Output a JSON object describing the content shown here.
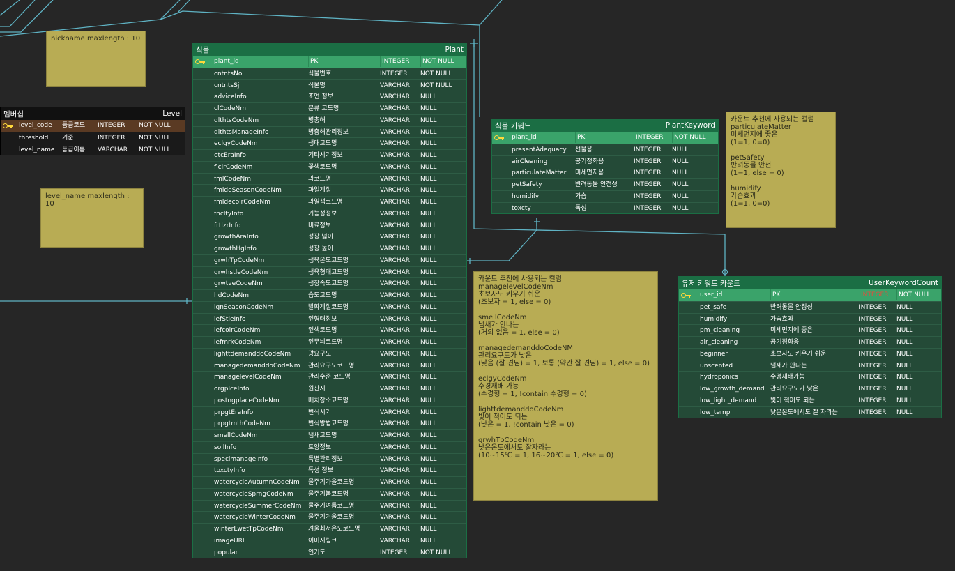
{
  "notes": {
    "nickname": [
      "nickname maxlength : 10"
    ],
    "level_name": [
      "level_name maxlength : 10"
    ],
    "plant_reco": [
      "카운트 추천에 사용되는 컬럼",
      "managelevelCodeNm",
      "초보자도 키우기 쉬운",
      "(초보자 = 1, else = 0)",
      "",
      "smellCodeNm",
      "냄새가 안나는",
      "(거의 없음 = 1, else = 0)",
      "",
      "managedemanddoCodeNM",
      "관리요구도가 낮은",
      "(낮음 (잘 견딤) = 1, 보통 (약간 잘 견딤) = 1, else = 0)",
      "",
      "eclgyCodeNm",
      "수경재배 가능",
      "(수경형 = 1, !contain 수경형 = 0)",
      "",
      "lighttdemanddoCodeNm",
      "빛이 적어도 되는",
      "(낮은 = 1, !contain 낮은 = 0)",
      "",
      "grwhTpCodeNm",
      "낮은온도에서도 잘자라는",
      "(10~15℃ = 1, 16~20℃ = 1, else = 0)"
    ],
    "keyword_reco": [
      "카운트 추천에 사용되는 컬럼",
      "particulateMatter",
      "미세먼지에 좋은",
      "(1=1, 0=0)",
      "",
      "petSafety",
      "반려동물 안전",
      "(1=1, else = 0)",
      "",
      "humidify",
      "가습효과",
      "(1=1, 0=0)"
    ]
  },
  "level": {
    "logical": "멤버십",
    "physical": "Level",
    "rows": [
      {
        "col": "level_code",
        "name": "등급코드",
        "type": "INTEGER",
        "nn": "NOT NULL",
        "pk": true
      },
      {
        "col": "threshold",
        "name": "기준",
        "type": "INTEGER",
        "nn": "NOT NULL",
        "pk": false
      },
      {
        "col": "level_name",
        "name": "등급이름",
        "type": "VARCHAR",
        "nn": "NOT NULL",
        "pk": false
      }
    ]
  },
  "plant": {
    "logical": "식물",
    "physical": "Plant",
    "rows": [
      {
        "col": "plant_id",
        "name": "PK",
        "type": "INTEGER",
        "nn": "NOT NULL",
        "pk": true
      },
      {
        "col": "cntntsNo",
        "name": "식물번호",
        "type": "INTEGER",
        "nn": "NOT NULL",
        "pk": false
      },
      {
        "col": "cntntsSj",
        "name": "식물명",
        "type": "VARCHAR",
        "nn": "NOT NULL",
        "pk": false
      },
      {
        "col": "adviceInfo",
        "name": "조언 정보",
        "type": "VARCHAR",
        "nn": "NULL",
        "pk": false
      },
      {
        "col": "clCodeNm",
        "name": "분류 코드명",
        "type": "VARCHAR",
        "nn": "NULL",
        "pk": false
      },
      {
        "col": "dlthtsCodeNm",
        "name": "병충해",
        "type": "VARCHAR",
        "nn": "NULL",
        "pk": false
      },
      {
        "col": "dlthtsManageInfo",
        "name": "병충해관리정보",
        "type": "VARCHAR",
        "nn": "NULL",
        "pk": false
      },
      {
        "col": "eclgyCodeNm",
        "name": "생태코드명",
        "type": "VARCHAR",
        "nn": "NULL",
        "pk": false
      },
      {
        "col": "etcEraInfo",
        "name": "기타시기정보",
        "type": "VARCHAR",
        "nn": "NULL",
        "pk": false
      },
      {
        "col": "flclrCodeNm",
        "name": "꽃색코드명",
        "type": "VARCHAR",
        "nn": "NULL",
        "pk": false
      },
      {
        "col": "fmlCodeNm",
        "name": "과코드명",
        "type": "VARCHAR",
        "nn": "NULL",
        "pk": false
      },
      {
        "col": "fmldeSeasonCodeNm",
        "name": "과일계절",
        "type": "VARCHAR",
        "nn": "NULL",
        "pk": false
      },
      {
        "col": "fmldecolrCodeNm",
        "name": "과일색코드명",
        "type": "VARCHAR",
        "nn": "NULL",
        "pk": false
      },
      {
        "col": "fncltyInfo",
        "name": "기능성정보",
        "type": "VARCHAR",
        "nn": "NULL",
        "pk": false
      },
      {
        "col": "frtlzrInfo",
        "name": "비료정보",
        "type": "VARCHAR",
        "nn": "NULL",
        "pk": false
      },
      {
        "col": "growthAraInfo",
        "name": "성장 넓이",
        "type": "VARCHAR",
        "nn": "NULL",
        "pk": false
      },
      {
        "col": "growthHgInfo",
        "name": "성장 높이",
        "type": "VARCHAR",
        "nn": "NULL",
        "pk": false
      },
      {
        "col": "grwhTpCodeNm",
        "name": "생육온도코드명",
        "type": "VARCHAR",
        "nn": "NULL",
        "pk": false
      },
      {
        "col": "grwhstleCodeNm",
        "name": "생육형태코드명",
        "type": "VARCHAR",
        "nn": "NULL",
        "pk": false
      },
      {
        "col": "grwtveCodeNm",
        "name": "생장속도코드명",
        "type": "VARCHAR",
        "nn": "NULL",
        "pk": false
      },
      {
        "col": "hdCodeNm",
        "name": "습도코드명",
        "type": "VARCHAR",
        "nn": "NULL",
        "pk": false
      },
      {
        "col": "ignSeasonCodeNm",
        "name": "발화계절코드명",
        "type": "VARCHAR",
        "nn": "NULL",
        "pk": false
      },
      {
        "col": "lefStleInfo",
        "name": "잎형태정보",
        "type": "VARCHAR",
        "nn": "NULL",
        "pk": false
      },
      {
        "col": "lefcolrCodeNm",
        "name": "잎색코드명",
        "type": "VARCHAR",
        "nn": "NULL",
        "pk": false
      },
      {
        "col": "lefmrkCodeNm",
        "name": "잎무늬코드명",
        "type": "VARCHAR",
        "nn": "NULL",
        "pk": false
      },
      {
        "col": "lighttdemanddoCodeNm",
        "name": "광요구도",
        "type": "VARCHAR",
        "nn": "NULL",
        "pk": false
      },
      {
        "col": "managedemanddoCodeNm",
        "name": "관리요구도코드명",
        "type": "VARCHAR",
        "nn": "NULL",
        "pk": false
      },
      {
        "col": "managelevelCodeNm",
        "name": "관리수준 코드명",
        "type": "VARCHAR",
        "nn": "NULL",
        "pk": false
      },
      {
        "col": "orgplceInfo",
        "name": "원산지",
        "type": "VARCHAR",
        "nn": "NULL",
        "pk": false
      },
      {
        "col": "postngplaceCodeNm",
        "name": "배치장소코드명",
        "type": "VARCHAR",
        "nn": "NULL",
        "pk": false
      },
      {
        "col": "prpgtEraInfo",
        "name": "번식시기",
        "type": "VARCHAR",
        "nn": "NULL",
        "pk": false
      },
      {
        "col": "prpgtmthCodeNm",
        "name": "번식방법코드명",
        "type": "VARCHAR",
        "nn": "NULL",
        "pk": false
      },
      {
        "col": "smellCodeNm",
        "name": "냄새코드명",
        "type": "VARCHAR",
        "nn": "NULL",
        "pk": false
      },
      {
        "col": "soilInfo",
        "name": "토양정보",
        "type": "VARCHAR",
        "nn": "NULL",
        "pk": false
      },
      {
        "col": "speclmanageInfo",
        "name": "특별관리정보",
        "type": "VARCHAR",
        "nn": "NULL",
        "pk": false
      },
      {
        "col": "toxctyInfo",
        "name": "독성 정보",
        "type": "VARCHAR",
        "nn": "NULL",
        "pk": false
      },
      {
        "col": "watercycleAutumnCodeNm",
        "name": "물주기가을코드명",
        "type": "VARCHAR",
        "nn": "NULL",
        "pk": false
      },
      {
        "col": "watercycleSprngCodeNm",
        "name": "물주기봄코드명",
        "type": "VARCHAR",
        "nn": "NULL",
        "pk": false
      },
      {
        "col": "watercycleSummerCodeNm",
        "name": "물주기여름코드명",
        "type": "VARCHAR",
        "nn": "NULL",
        "pk": false
      },
      {
        "col": "watercycleWinterCodeNm",
        "name": "물주기겨울코드명",
        "type": "VARCHAR",
        "nn": "NULL",
        "pk": false
      },
      {
        "col": "winterLwetTpCodeNm",
        "name": "겨울최저온도코드명",
        "type": "VARCHAR",
        "nn": "NULL",
        "pk": false
      },
      {
        "col": "imageURL",
        "name": "이미지링크",
        "type": "VARCHAR",
        "nn": "NULL",
        "pk": false
      },
      {
        "col": "popular",
        "name": "인기도",
        "type": "INTEGER",
        "nn": "NOT NULL",
        "pk": false
      }
    ]
  },
  "plant_keyword": {
    "logical": "식물 키워드",
    "physical": "PlantKeyword",
    "rows": [
      {
        "col": "plant_id",
        "name": "PK",
        "type": "INTEGER",
        "nn": "NOT NULL",
        "pk": true
      },
      {
        "col": "presentAdequacy",
        "name": "선물용",
        "type": "INTEGER",
        "nn": "NULL",
        "pk": false
      },
      {
        "col": "airCleaning",
        "name": "공기정화용",
        "type": "INTEGER",
        "nn": "NULL",
        "pk": false
      },
      {
        "col": "particulateMatter",
        "name": "미세먼지용",
        "type": "INTEGER",
        "nn": "NULL",
        "pk": false
      },
      {
        "col": "petSafety",
        "name": "반려동물 안전성",
        "type": "INTEGER",
        "nn": "NULL",
        "pk": false
      },
      {
        "col": "humidify",
        "name": "가습",
        "type": "INTEGER",
        "nn": "NULL",
        "pk": false
      },
      {
        "col": "toxcty",
        "name": "독성",
        "type": "INTEGER",
        "nn": "NULL",
        "pk": false
      }
    ]
  },
  "user_keyword_count": {
    "logical": "유저 키워드 카운트",
    "physical": "UserKeywordCount",
    "rows": [
      {
        "col": "user_id",
        "name": "PK",
        "type": "INTEGER",
        "nn": "NOT NULL",
        "pk": true,
        "type_warn": true
      },
      {
        "col": "pet_safe",
        "name": "반려동물 안정성",
        "type": "INTEGER",
        "nn": "NULL",
        "pk": false
      },
      {
        "col": "humidify",
        "name": "가습효과",
        "type": "INTEGER",
        "nn": "NULL",
        "pk": false
      },
      {
        "col": "pm_cleaning",
        "name": "미세먼지에 좋은",
        "type": "INTEGER",
        "nn": "NULL",
        "pk": false
      },
      {
        "col": "air_cleaning",
        "name": "공기정화용",
        "type": "INTEGER",
        "nn": "NULL",
        "pk": false
      },
      {
        "col": "beginner",
        "name": "초보자도 키우기 쉬운",
        "type": "INTEGER",
        "nn": "NULL",
        "pk": false
      },
      {
        "col": "unscented",
        "name": "냄새가 안나는",
        "type": "INTEGER",
        "nn": "NULL",
        "pk": false
      },
      {
        "col": "hydroponics",
        "name": "수경재배가능",
        "type": "INTEGER",
        "nn": "NULL",
        "pk": false
      },
      {
        "col": "low_growth_demand",
        "name": "관리요구도가 낮은",
        "type": "INTEGER",
        "nn": "NULL",
        "pk": false
      },
      {
        "col": "low_light_demand",
        "name": "빛이 적어도 되는",
        "type": "INTEGER",
        "nn": "NULL",
        "pk": false
      },
      {
        "col": "low_temp",
        "name": "낮은온도에서도 잘 자라는",
        "type": "INTEGER",
        "nn": "NULL",
        "pk": false
      }
    ]
  },
  "colors": {
    "canvas": "#262626",
    "entity_header": "#1b6e44",
    "entity_body": "#244a37",
    "pk_row": "#3aa36a",
    "key_icon": "#ffd83b",
    "note": "#b8ac54",
    "connector": "#5fb3c4",
    "warn_text": "#e84b3a"
  }
}
